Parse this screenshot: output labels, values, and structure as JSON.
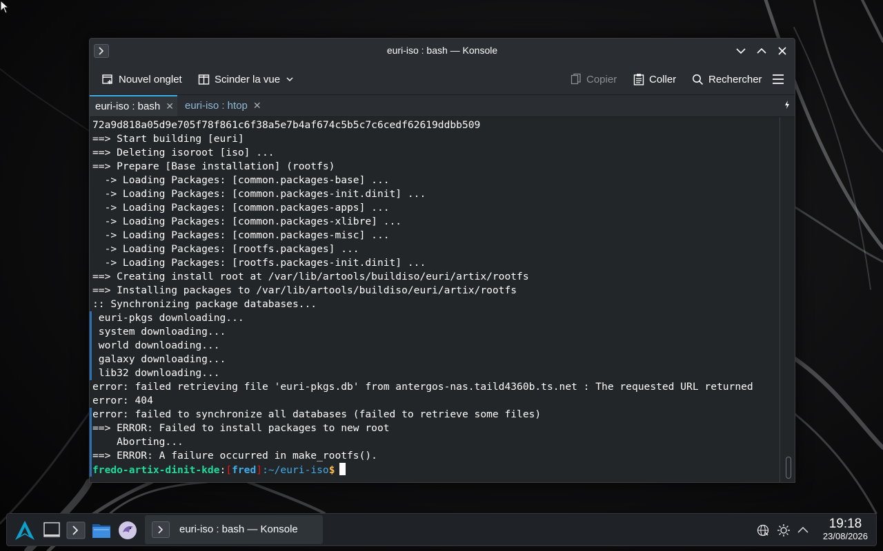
{
  "window": {
    "title": "euri-iso : bash — Konsole"
  },
  "toolbar": {
    "new_tab": "Nouvel onglet",
    "split_view": "Scinder la vue",
    "copy": "Copier",
    "paste": "Coller",
    "search": "Rechercher"
  },
  "tabs": [
    {
      "label": "euri-iso : bash",
      "active": true
    },
    {
      "label": "euri-iso : htop",
      "active": false
    }
  ],
  "terminal": {
    "lines": [
      "72a9d818a05d9e705f78f861c6f38a5e7b4af674c5b5c7c6cedf62619ddbb509",
      "==> Start building [euri]",
      "==> Deleting isoroot [iso] ...",
      "==> Prepare [Base installation] (rootfs)",
      "  -> Loading Packages: [common.packages-base] ...",
      "  -> Loading Packages: [common.packages-init.dinit] ...",
      "  -> Loading Packages: [common.packages-apps] ...",
      "  -> Loading Packages: [common.packages-xlibre] ...",
      "  -> Loading Packages: [common.packages-misc] ...",
      "  -> Loading Packages: [rootfs.packages] ...",
      "  -> Loading Packages: [rootfs.packages-init.dinit] ...",
      "==> Creating install root at /var/lib/artools/buildiso/euri/artix/rootfs",
      "==> Installing packages to /var/lib/artools/buildiso/euri/artix/rootfs",
      ":: Synchronizing package databases...",
      " euri-pkgs downloading...",
      " system downloading...",
      " world downloading...",
      " galaxy downloading...",
      " lib32 downloading...",
      "error: failed retrieving file 'euri-pkgs.db' from antergos-nas.taild4360b.ts.net : The requested URL returned",
      "error: 404",
      "error: failed to synchronize all databases (failed to retrieve some files)",
      "==> ERROR: Failed to install packages to new root",
      "    Aborting...",
      "==> ERROR: A failure occurred in make_rootfs()."
    ],
    "prompt": {
      "host": "fredo-artix-dinit-kde",
      "sep": ":",
      "open": "[",
      "user": "fred",
      "close": "]",
      "path": ":~/euri-iso",
      "symbol": "$"
    }
  },
  "taskbar": {
    "task_label": "euri-iso : bash — Konsole",
    "time": "19:18",
    "date": "23/08/2026"
  },
  "icons": {
    "launcher": "artix-logo-icon",
    "desktop": "show-desktop-icon",
    "konsole": "konsole-icon",
    "files": "dolphin-folder-icon",
    "browser": "bird-browser-icon",
    "network": "network-globe-icon",
    "brightness": "brightness-icon",
    "tray_expand": "chevron-up-icon"
  },
  "colors": {
    "accent": "#3daee9",
    "prompt_host": "#1cdc9a",
    "prompt_bracket": "#ed1515",
    "prompt_symbol": "#fdbc4b",
    "terminal_bg": "#232629"
  }
}
